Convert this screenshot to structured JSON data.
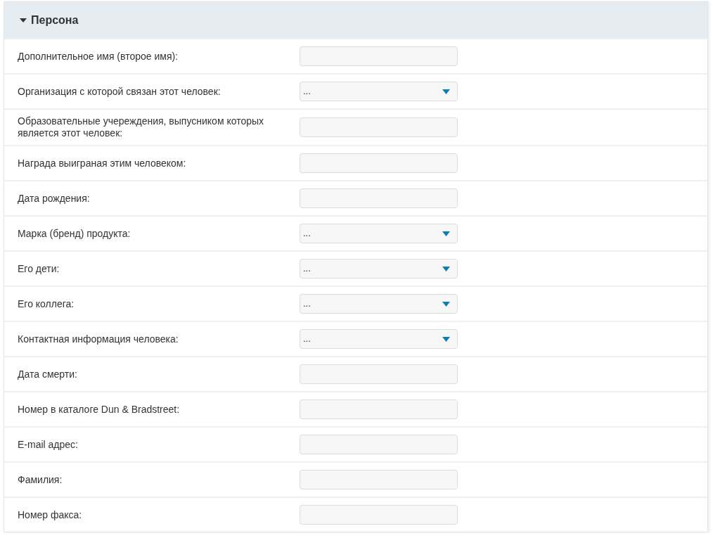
{
  "section": {
    "title": "Персона",
    "expanded": true
  },
  "fields": [
    {
      "label": "Дополнительное имя (второе имя):",
      "kind": "text"
    },
    {
      "label": "Организация с которой связан этот человек:",
      "kind": "select",
      "value": "..."
    },
    {
      "label": "Образовательные учереждения, выпусником которых является этот человек:",
      "kind": "text"
    },
    {
      "label": "Награда выиграная этим человеком:",
      "kind": "text"
    },
    {
      "label": "Дата рождения:",
      "kind": "text"
    },
    {
      "label": "Марка (бренд) продукта:",
      "kind": "select",
      "value": "..."
    },
    {
      "label": "Его дети:",
      "kind": "select",
      "value": "..."
    },
    {
      "label": "Его коллега:",
      "kind": "select",
      "value": "..."
    },
    {
      "label": "Контактная информация человека:",
      "kind": "select",
      "value": "..."
    },
    {
      "label": "Дата смерти:",
      "kind": "text"
    },
    {
      "label": "Номер в каталоге Dun & Bradstreet:",
      "kind": "text"
    },
    {
      "label": "E-mail адрес:",
      "kind": "text"
    },
    {
      "label": "Фамилия:",
      "kind": "text"
    },
    {
      "label": "Номер факса:",
      "kind": "text"
    }
  ]
}
